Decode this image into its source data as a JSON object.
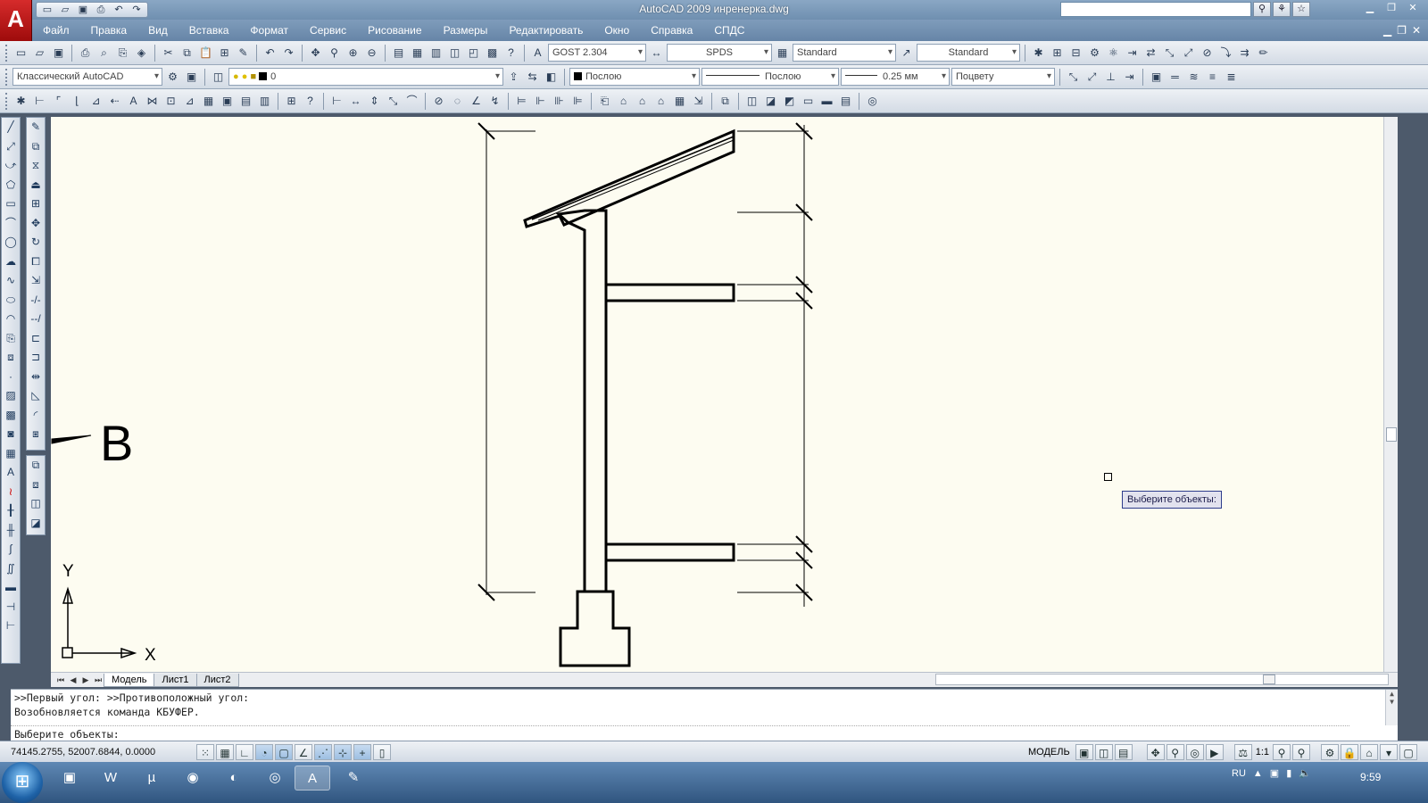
{
  "titlebar": {
    "title": "AutoCAD 2009 инренерка.dwg",
    "logo": "A",
    "qat_icons": [
      "new-icon",
      "open-icon",
      "save-icon",
      "print-icon",
      "undo-icon",
      "redo-icon"
    ],
    "search_tools": [
      "binoculars-icon",
      "star-icon",
      "favorites-icon"
    ],
    "window_controls": [
      "minimize",
      "restore",
      "close"
    ]
  },
  "menubar": {
    "items": [
      "Файл",
      "Правка",
      "Вид",
      "Вставка",
      "Формат",
      "Сервис",
      "Рисование",
      "Размеры",
      "Редактировать",
      "Окно",
      "Справка",
      "СПДС"
    ]
  },
  "toolbar1": {
    "text_style": "GOST 2.304",
    "dim_style": "SPDS",
    "table_style": "Standard",
    "mleader_style": "Standard"
  },
  "toolbar2": {
    "workspace": "Классический AutoCAD",
    "layer": "0",
    "color": "Послою",
    "linetype": "Послою",
    "lineweight": "0.25 мм",
    "plotstyle": "Поцвету"
  },
  "drawing": {
    "section_letter": "В",
    "y_axis": "Y",
    "x_axis": "X"
  },
  "tooltip": "Выберите объекты:",
  "tabs": [
    "Модель",
    "Лист1",
    "Лист2"
  ],
  "command": {
    "line1": ">>Первый угол: >>Противоположный угол:",
    "line2": "Возобновляется команда КБУФЕР.",
    "prompt": "Выберите объекты:"
  },
  "status": {
    "coords": "74145.2755, 52007.6844, 0.0000",
    "model": "МОДЕЛЬ",
    "scale": "1:1"
  },
  "taskbar": {
    "lang": "RU",
    "time": "9:59"
  }
}
